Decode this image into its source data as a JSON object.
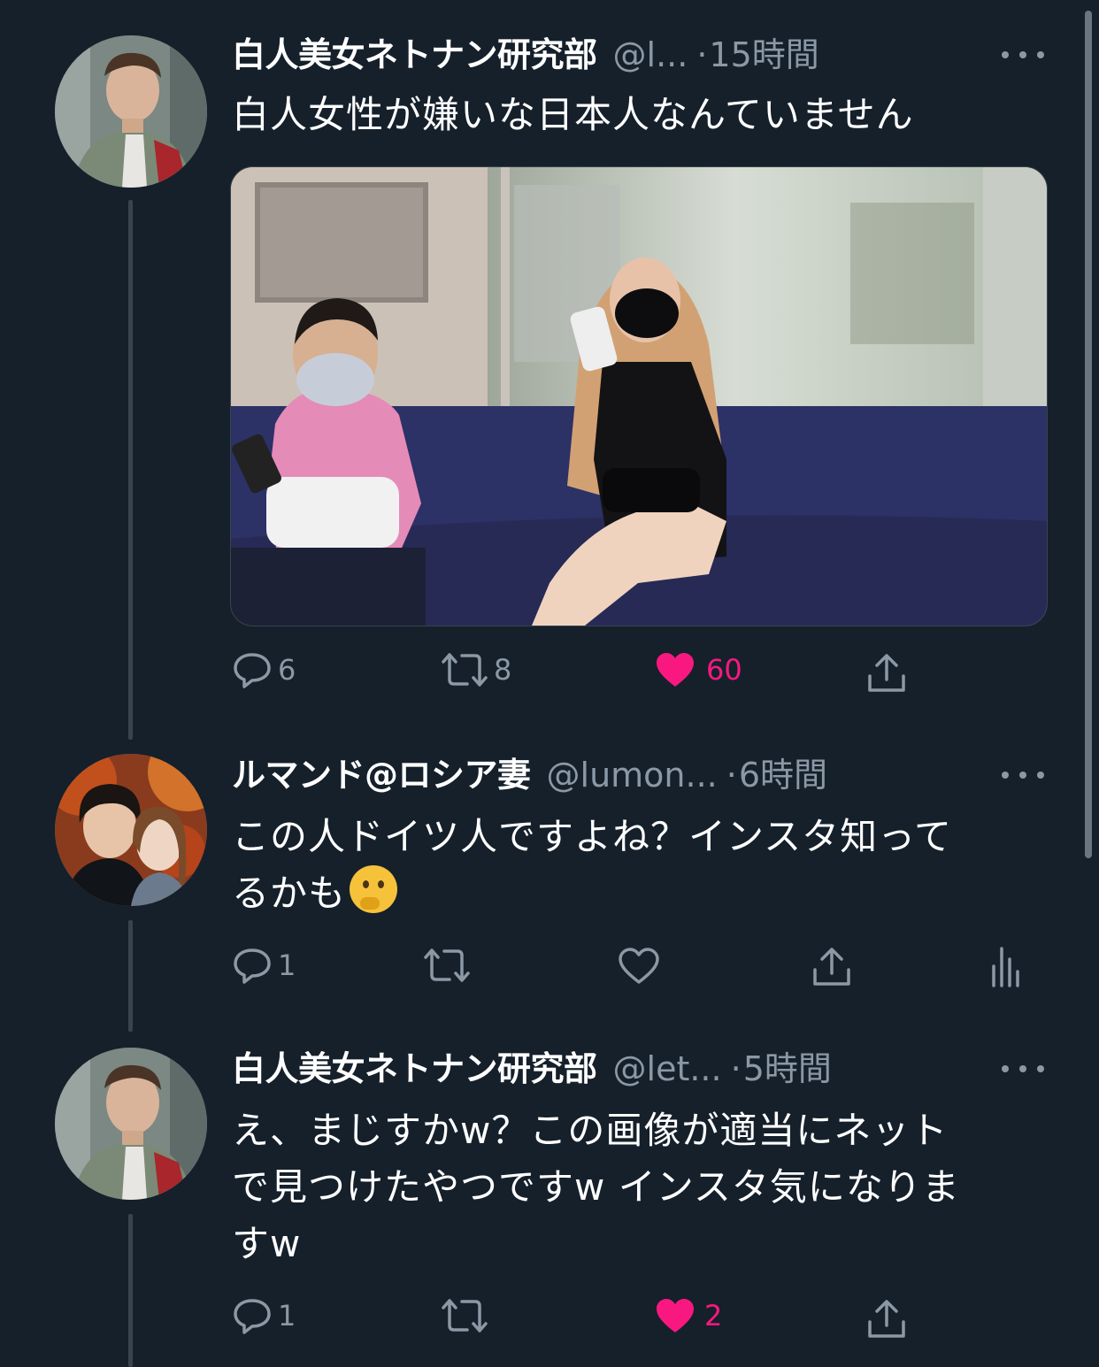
{
  "colors": {
    "background": "#15202b",
    "text_primary": "#ffffff",
    "text_secondary": "#8b98a5",
    "like_active": "#f91880",
    "thread_line": "#38444d"
  },
  "tweets": [
    {
      "name": "白人美女ネトナン研究部",
      "handle": "@l...",
      "dot": "·",
      "time": "15時間",
      "text": "白人女性が嫌いな日本人なんていません",
      "has_media": true,
      "actions": {
        "reply_icon": "reply-icon",
        "reply_count": "6",
        "retweet_icon": "retweet-icon",
        "retweet_count": "8",
        "like_icon": "heart-filled-icon",
        "like_count": "60",
        "liked": true,
        "share_icon": "share-icon"
      }
    },
    {
      "name": "ルマンド@ロシア妻",
      "handle": "@lumon...",
      "dot": "·",
      "time": "6時間",
      "text_line1": "この人ドイツ人ですよね？インスタ知って",
      "text_line2": "るかも",
      "emoji": "thinking-face-emoji",
      "actions": {
        "reply_icon": "reply-icon",
        "reply_count": "1",
        "retweet_icon": "retweet-icon",
        "retweet_count": "",
        "like_icon": "heart-outline-icon",
        "like_count": "",
        "liked": false,
        "share_icon": "share-icon",
        "analytics_icon": "analytics-icon"
      }
    },
    {
      "name": "白人美女ネトナン研究部",
      "handle": "@let...",
      "dot": "·",
      "time": "5時間",
      "text_line1": "え、まじすかw？この画像が適当にネット",
      "text_line2": "で見つけたやつですw インスタ気になりま",
      "text_line3": "すw",
      "actions": {
        "reply_icon": "reply-icon",
        "reply_count": "1",
        "retweet_icon": "retweet-icon",
        "retweet_count": "",
        "like_icon": "heart-filled-icon",
        "like_count": "2",
        "liked": true,
        "share_icon": "share-icon"
      }
    }
  ],
  "more_icon": "more-horizontal-icon"
}
